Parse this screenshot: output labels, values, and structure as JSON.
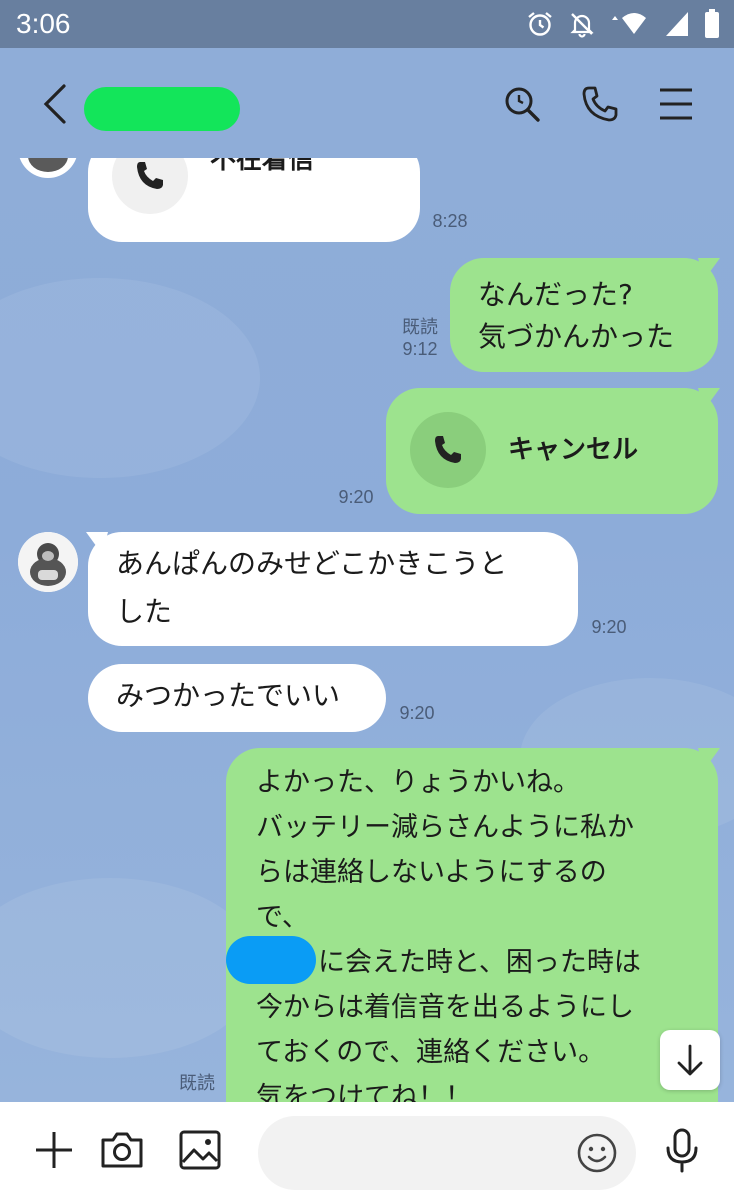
{
  "status_bar": {
    "time": "3:06",
    "icons": [
      "alarm-icon",
      "notifications-off-icon",
      "wifi-icon",
      "signal-icon",
      "battery-icon"
    ]
  },
  "header": {
    "icons": [
      "back-icon",
      "search-icon",
      "call-icon",
      "menu-icon"
    ]
  },
  "messages": [
    {
      "side": "left",
      "type": "call",
      "label": "不在着信",
      "time": "8:28"
    },
    {
      "side": "right",
      "type": "text",
      "lines": [
        "なんだった?",
        "気づかんかった"
      ],
      "read": "既読",
      "time": "9:12"
    },
    {
      "side": "right",
      "type": "call",
      "label": "キャンセル",
      "time": "9:20"
    },
    {
      "side": "left",
      "type": "text",
      "lines": [
        "あんぱんのみせどこかきこうと",
        "した"
      ],
      "time": "9:20"
    },
    {
      "side": "left",
      "type": "text",
      "lines": [
        "みつかったでいい"
      ],
      "time": "9:20"
    },
    {
      "side": "right",
      "type": "text",
      "lines": [
        "よかった、りょうかいね。",
        "バッテリー減らさんように私か",
        "らは連絡しないようにするの",
        "で、",
        "に会えた時と、困った時は",
        "今からは着信音を出るようにし",
        "ておくので、連絡ください。",
        "気をつけてね！！"
      ],
      "read": "既読"
    }
  ],
  "bottom_bar": {
    "icons": [
      "add-icon",
      "camera-icon",
      "image-icon",
      "emoji-icon",
      "microphone-icon"
    ]
  },
  "colors": {
    "background": "#8fadd8",
    "outgoing": "#9de38e",
    "incoming": "#ffffff",
    "status_bar": "#687f9f"
  }
}
